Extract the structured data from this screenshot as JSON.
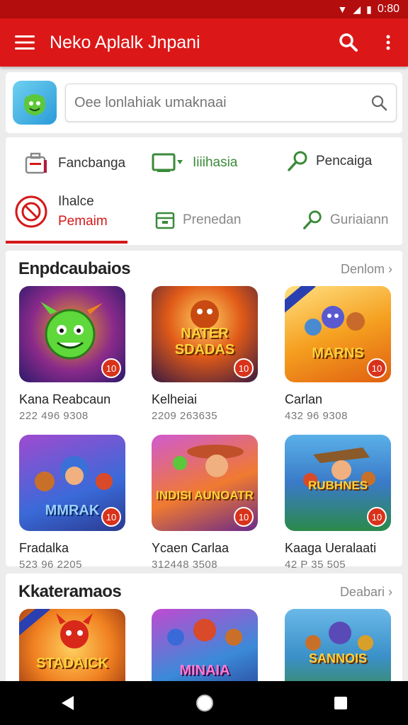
{
  "status_bar": {
    "time": "0:80"
  },
  "app_bar": {
    "title": "Neko Aplalk Jnpani"
  },
  "search": {
    "placeholder": "Oee lonlahiak umaknaai"
  },
  "categories": {
    "items": [
      {
        "label": "Fancbanga"
      },
      {
        "label": "Iiiihasia"
      },
      {
        "label": "Pencaiga"
      }
    ],
    "active_tab": {
      "line1": "Ihalce",
      "line2": "Pemaim"
    },
    "tabs": [
      {
        "label": "Prenedan"
      },
      {
        "label": "Guriaiann"
      }
    ]
  },
  "sections": [
    {
      "title": "Enpdcaubaios",
      "see_more": "Denlom",
      "cards": [
        {
          "name": "Kana Reabcaun",
          "meta": "222 496 9308",
          "badge": "10",
          "logo": ""
        },
        {
          "name": "Kelheiai",
          "meta": "2209 263635",
          "badge": "10",
          "logo": "NATER SDADAS"
        },
        {
          "name": "Carlan",
          "meta": "432 96 9308",
          "badge": "10",
          "logo": "MARNS"
        },
        {
          "name": "Fradalka",
          "meta": "523 96 2205",
          "badge": "10",
          "logo": "MMRAK"
        },
        {
          "name": "Ycaen Carlaa",
          "meta": "312448 3508",
          "badge": "10",
          "logo": "INDISI AUNOATR"
        },
        {
          "name": "Kaaga Ueralaati",
          "meta": "42 P 35 505",
          "badge": "10",
          "logo": "RUBHNES"
        }
      ]
    },
    {
      "title": "Kkateramaos",
      "see_more": "Deabari",
      "cards": [
        {
          "logo": "STADAICK"
        },
        {
          "logo": "MINAIA"
        },
        {
          "logo": "SANNOIS"
        }
      ]
    }
  ],
  "colors": {
    "primary": "#dc1717",
    "accent_green": "#3a8a3a",
    "badge": "#d9321b"
  }
}
